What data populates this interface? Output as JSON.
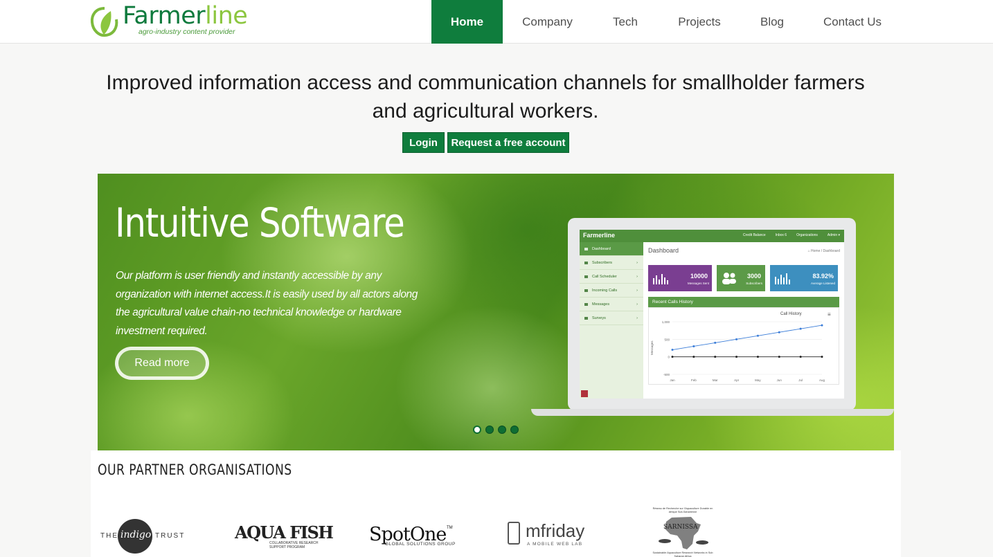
{
  "logo": {
    "name_part1": "Farmer",
    "name_part2": "line",
    "tagline": "agro-industry content provider"
  },
  "nav": [
    {
      "label": "Home",
      "active": true
    },
    {
      "label": "Company",
      "active": false
    },
    {
      "label": "Tech",
      "active": false
    },
    {
      "label": "Projects",
      "active": false
    },
    {
      "label": "Blog",
      "active": false
    },
    {
      "label": "Contact Us",
      "active": false
    }
  ],
  "hero": {
    "line1": "Improved information access and communication channels for smallholder farmers",
    "line2": "and agricultural workers.",
    "login_label": "Login",
    "request_label": "Request a free account"
  },
  "slider": {
    "title": "Intuitive Software",
    "body": "Our platform is user friendly and instantly accessible by any organization with internet access.It is easily used by all actors along the agricultural value chain-no technical knowledge or hardware investment required.",
    "read_more": "Read more",
    "dots_count": 4,
    "active_dot": 0
  },
  "dashboard": {
    "brand": "Farmerline",
    "top_credit": "Credit Balance",
    "top_inbox": "Inbox",
    "top_inbox_count": "6",
    "top_orgs": "Organizations",
    "top_admin": "Admin ▾",
    "sidebar": [
      "Dashboard",
      "Subscribers",
      "Call Scheduler",
      "Incoming Calls",
      "Messages",
      "Surveys"
    ],
    "title": "Dashboard",
    "breadcrumb": "⌂ Home / Dashboard",
    "stats": [
      {
        "value": "10000",
        "label": "Messages Sent",
        "color": "#7a3e91"
      },
      {
        "value": "3000",
        "label": "Subscribers",
        "color": "#5c9a48"
      },
      {
        "value": "83.92%",
        "label": "Average Listened",
        "color": "#3d8fbf"
      }
    ],
    "panel_title": "Recent Calls History",
    "chart_data": {
      "type": "line",
      "title": "Call History",
      "ylabel": "Messages",
      "categories": [
        "Jan",
        "Feb",
        "Mar",
        "Apr",
        "May",
        "Jun",
        "Jul",
        "Aug"
      ],
      "yticks": [
        "1,000",
        "500",
        "0",
        "-500"
      ],
      "ylim": [
        -500,
        1000
      ],
      "series": [
        {
          "values": [
            200,
            300,
            400,
            500,
            600,
            700,
            800,
            900
          ],
          "color": "#3b7dd8"
        },
        {
          "values": [
            0,
            0,
            0,
            0,
            0,
            0,
            0,
            0
          ],
          "color": "#222222"
        }
      ]
    }
  },
  "partners": {
    "title": "OUR PARTNER ORGANISATIONS",
    "indigo": {
      "the": "THE",
      "indigo": "indigo",
      "trust": "TRUST"
    },
    "aquafish": {
      "name": "AQUA FISH",
      "sub1": "COLLABORATIVE RESEARCH",
      "sub2": "SUPPORT PROGRAM"
    },
    "spotone": {
      "name": "SpotOne",
      "tm": "TM",
      "sub": "GLOBAL SOLUTIONS GROUP"
    },
    "mfriday": {
      "name": "mfriday",
      "sub": "A MOBILE WEB LAB"
    },
    "sarnissa": {
      "top": "Réseau de Recherche sur l'Aquaculture Durable en Afrique Sub-Saharienne",
      "name": "SARNISSA",
      "bottom": "Sustainable Aquaculture Research Networks in Sub Saharan Africa"
    }
  }
}
